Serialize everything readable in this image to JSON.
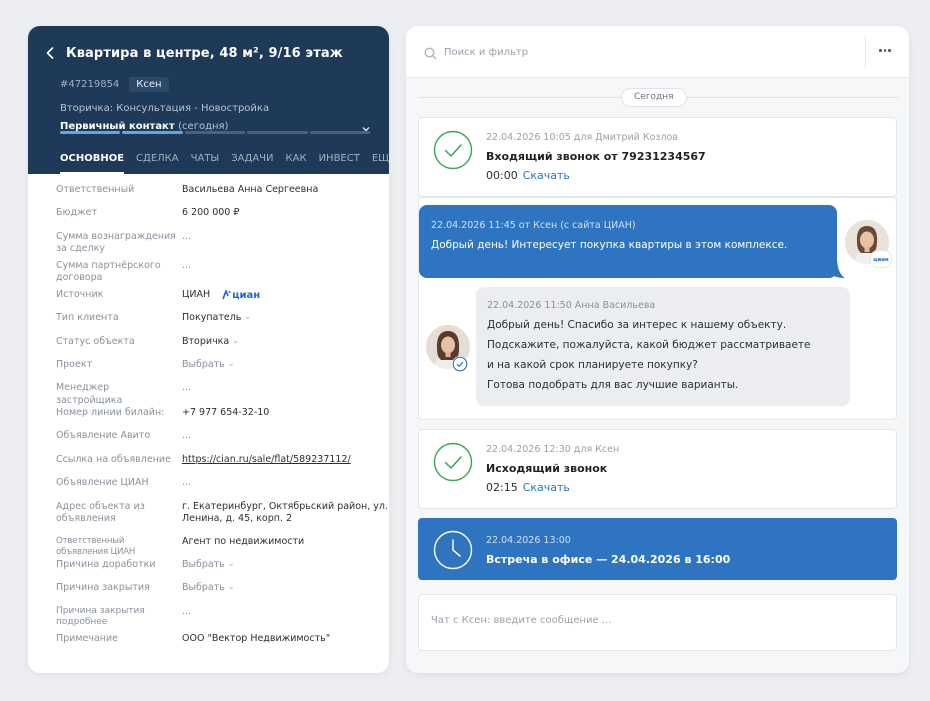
{
  "deal": {
    "title": "Квартира в центре, 48 м², 9/16 этаж",
    "id": "#47219854",
    "owner": "Ксен",
    "pipeline": "Вторичка: Консультация - Новостройка",
    "stage": "Первичный контакт",
    "stage_date": "(сегодня)",
    "progress_filled_segments": 2,
    "progress_total_segments": 5
  },
  "tabs": [
    {
      "label": "ОСНОВНОЕ",
      "active": true
    },
    {
      "label": "СДЕЛКА",
      "active": false
    },
    {
      "label": "ЧАТЫ",
      "active": false
    },
    {
      "label": "ЗАДАЧИ",
      "active": false
    },
    {
      "label": "КАК",
      "active": false
    },
    {
      "label": "ИНВЕСТ",
      "active": false
    },
    {
      "label": "ЕЩЁ",
      "active": false
    }
  ],
  "fields": {
    "responsible": {
      "label": "Ответственный",
      "value": "Васильева Анна Сергеевна"
    },
    "budget": {
      "label": "Бюджет",
      "value": "6 200 000 ₽"
    },
    "commission": {
      "label": "Сумма вознаграждения за сделку",
      "value": "..."
    },
    "partner_sum": {
      "label": "Сумма партнёрского договора",
      "value": "..."
    },
    "source": {
      "label": "Источник",
      "value": "ЦИАН",
      "logo_text": "циан"
    },
    "client_type": {
      "label": "Тип клиента",
      "value": "Покупатель"
    },
    "object_status": {
      "label": "Статус объекта",
      "value": "Вторичка"
    },
    "project": {
      "label": "Проект",
      "value": "Выбрать"
    },
    "dev_manager": {
      "label": "Менеджер застройщика",
      "value": "..."
    },
    "beeline_line": {
      "label": "Номер линии билайн:",
      "value": "+7 977 654-32-10"
    },
    "avito_ad": {
      "label": "Объявление Авито",
      "value": "..."
    },
    "ad_link": {
      "label": "Ссылка на объявление",
      "value": "https://cian.ru/sale/flat/589237112/"
    },
    "cian_ad": {
      "label": "Объявление ЦИАН",
      "value": "..."
    },
    "address": {
      "label": "Адрес объекта из объявления",
      "value": "г. Екатеринбург, Октябрьский район, ул. Ленина, д. 45, корп. 2"
    },
    "cian_responsible": {
      "label": "Ответственный объявления ЦИАН",
      "value": "Агент по недвижимости"
    },
    "rework_reason": {
      "label": "Причина доработки",
      "value": "Выбрать"
    },
    "close_reason": {
      "label": "Причина закрытия",
      "value": "Выбрать"
    },
    "close_reason_details": {
      "label": "Причина закрытия подробнее",
      "value": "..."
    },
    "note": {
      "label": "Примечание",
      "value": "ООО \"Вектор Недвижимость\""
    }
  },
  "feed": {
    "search_placeholder": "Поиск и фильтр",
    "day_label": "Сегодня",
    "call_in": {
      "meta": "22.04.2026 10:05 для Дмитрий Козлов",
      "title": "Входящий звонок от 79231234567",
      "duration": "00:00",
      "download": "Скачать"
    },
    "msg_in": {
      "meta": "22.04.2026 11:45 от Ксен (с сайта ЦИАН)",
      "text": "Добрый день! Интересует покупка квартиры в этом комплексе.",
      "badge": "циан"
    },
    "msg_out": {
      "meta": "22.04.2026 11:50 Анна Васильева",
      "lines": [
        "Добрый день! Спасибо за интерес к нашему объекту.",
        "Подскажите, пожалуйста, какой бюджет рассматриваете",
        "и на какой срок планируете покупку?",
        "Готова подобрать для вас лучшие варианты."
      ]
    },
    "call_out": {
      "meta": "22.04.2026 12:30 для Ксен",
      "title": "Исходящий звонок",
      "duration": "02:15",
      "download": "Скачать"
    },
    "meeting": {
      "meta": "22.04.2026 13:00",
      "title": "Встреча в офисе — 24.04.2026 в 16:00"
    },
    "chat_placeholder": "Чат с Ксен: введите сообщение ..."
  },
  "colors": {
    "header_bg": "#1e3a58",
    "accent_blue": "#2f74c0",
    "progress_active": "#58a8ea",
    "success_green": "#3aa757"
  }
}
